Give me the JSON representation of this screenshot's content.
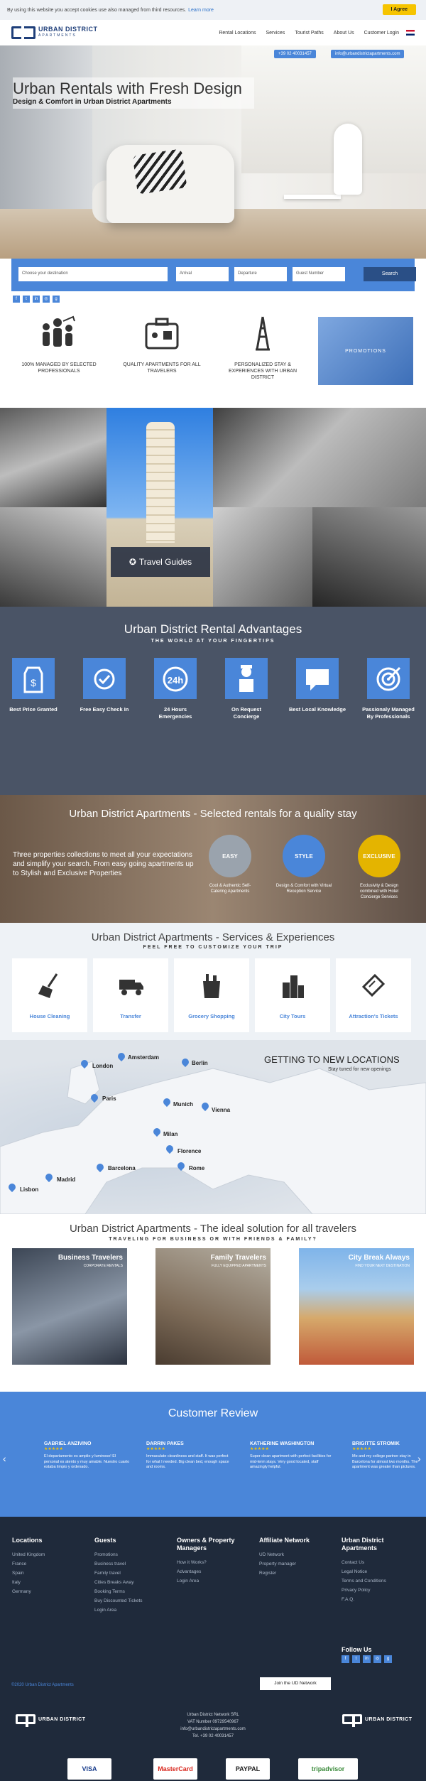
{
  "cookie": {
    "text": "By using this website you accept cookies use also managed from third resources.",
    "link": "Learn more",
    "agree": "I Agree"
  },
  "header": {
    "logo_line1": "URBAN DISTRICT",
    "logo_line2": "APARTMENTS",
    "nav": [
      "Rental Locations",
      "Services",
      "Tourist Paths",
      "About Us",
      "Customer Login"
    ]
  },
  "hero": {
    "phone": "+39 02 40031457",
    "email": "info@urbandistrictapartments.com",
    "title": "Urban Rentals with Fresh Design",
    "subtitle": "Design & Comfort in Urban District Apartments"
  },
  "search": {
    "destination": "Choose your destination",
    "arrival": "Arrival",
    "departure": "Departure",
    "guests": "Guest Number",
    "button": "Search"
  },
  "features": [
    {
      "label": "100% MANAGED BY SELECTED PROFESSIONALS",
      "icon": "people-chart-icon"
    },
    {
      "label": "QUALITY APARTMENTS FOR ALL TRAVELERS",
      "icon": "suitcase-icon"
    },
    {
      "label": "PERSONALIZED STAY & EXPERIENCES WITH URBAN DISTRICT",
      "icon": "eiffel-tower-icon"
    }
  ],
  "promotions": "PROMOTIONS",
  "gallery": {
    "guide": "Travel Guides"
  },
  "advantages": {
    "title": "Urban District Rental Advantages",
    "subtitle": "THE WORLD AT YOUR FINGERTIPS",
    "items": [
      {
        "label": "Best Price Granted",
        "icon": "price-tag-icon"
      },
      {
        "label": "Free Easy Check In",
        "icon": "check-in-icon"
      },
      {
        "label": "24 Hours Emergencies",
        "icon": "clock-24h-icon"
      },
      {
        "label": "On Request Concierge",
        "icon": "concierge-icon"
      },
      {
        "label": "Best Local Knowledge",
        "icon": "chat-bubble-icon"
      },
      {
        "label": "Passionaly Managed By Professionals",
        "icon": "target-icon"
      }
    ]
  },
  "selected": {
    "title": "Urban District Apartments - Selected rentals for a quality stay",
    "text": "Three properties collections to meet all your expectations and simplify your search. From easy going apartments up to Stylish and Exclusive Properties",
    "items": [
      {
        "name": "EASY",
        "desc": "Cool & Authentic Self-Catering Apartments",
        "color": "#9aa3ad"
      },
      {
        "name": "STYLE",
        "desc": "Design & Comfort with Virtual Reception Service",
        "color": "#4a86d9"
      },
      {
        "name": "EXCLUSIVE",
        "desc": "Exclusivity & Design combined with Hotel Concierge Services",
        "color": "#e4b400"
      }
    ]
  },
  "services": {
    "title": "Urban District Apartments - Services & Experiences",
    "subtitle": "FEEL FREE TO CUSTOMIZE YOUR TRIP",
    "items": [
      {
        "label": "House Cleaning",
        "icon": "broom-icon"
      },
      {
        "label": "Transfer",
        "icon": "truck-icon"
      },
      {
        "label": "Grocery Shopping",
        "icon": "grocery-bag-icon"
      },
      {
        "label": "City Tours",
        "icon": "city-buildings-icon"
      },
      {
        "label": "Attraction's Tickets",
        "icon": "ticket-icon"
      }
    ]
  },
  "map": {
    "title": "GETTING TO NEW LOCATIONS",
    "subtitle": "Stay tuned for new openings",
    "cities": [
      "Amsterdam",
      "London",
      "Berlin",
      "Paris",
      "Munich",
      "Vienna",
      "Milan",
      "Florence",
      "Rome",
      "Barcelona",
      "Madrid",
      "Lisbon"
    ]
  },
  "travelers": {
    "title": "Urban District Apartments - The ideal solution for all travelers",
    "subtitle": "TRAVELING FOR BUSINESS OR WITH FRIENDS & FAMILY?",
    "cards": [
      {
        "title": "Business Travelers",
        "sub": "CORPORATE RENTALS"
      },
      {
        "title": "Family Travelers",
        "sub": "FULLY EQUIPPED APARTMENTS"
      },
      {
        "title": "City Break Always",
        "sub": "FIND YOUR NEXT DESTINATION"
      }
    ]
  },
  "reviews": {
    "title": "Customer Review",
    "items": [
      {
        "name": "GABRIEL ANZIVINO",
        "stars": "★★★★★",
        "text": "El departamento es amplio y luminoso! El personal es atento y muy amable. Nuestro cuarto estaba limpio y ordenado."
      },
      {
        "name": "DARRIN PAKES",
        "stars": "★★★★★",
        "text": "Immaculate cleanliness and staff. It was perfect for what I needed. Big clean bed, enough space and rooms."
      },
      {
        "name": "KATHERINE WASHINGTON",
        "stars": "★★★★★",
        "text": "Super clean apartment with perfect facilities for mid-term stays. Very good located, staff amazingly helpful."
      },
      {
        "name": "BRIGITTE STROMIK",
        "stars": "★★★★★",
        "text": "Me and my college partner stay in Barcelona for almost two months. The apartment was greater than pictures."
      }
    ]
  },
  "footer": {
    "cols": [
      {
        "title": "Locations",
        "items": [
          "United Kingdom",
          "France",
          "Spain",
          "Italy",
          "Germany"
        ]
      },
      {
        "title": "Guests",
        "items": [
          "Promotions",
          "Business travel",
          "Family travel",
          "Cities Breaks Away",
          "Booking Terms",
          "Buy Discounted Tickets",
          "Login Area"
        ]
      },
      {
        "title": "Owners & Property Managers",
        "items": [
          "How it Works?",
          "Advantages",
          "Login Area"
        ]
      },
      {
        "title": "Affiliate Network",
        "items": [
          "UD Network",
          "Property manager",
          "Register"
        ]
      },
      {
        "title": "Urban District Apartments",
        "items": [
          "Contact Us",
          "Legal Notice",
          "Terms and Conditions",
          "Privacy Policy",
          "F.A.Q."
        ]
      }
    ],
    "follow": "Follow Us",
    "join": "Join the UD Network",
    "copyright": "©2020 Urban District Apartments",
    "company": "Urban District Network SRL",
    "vat": "VAT Number 09729540967",
    "email": "info@urbandistrictapartments.com",
    "tel": "Tel. +39 02 40031457",
    "payments": [
      "VISA",
      "MasterCard",
      "PAYPAL",
      "tripadvisor"
    ]
  }
}
